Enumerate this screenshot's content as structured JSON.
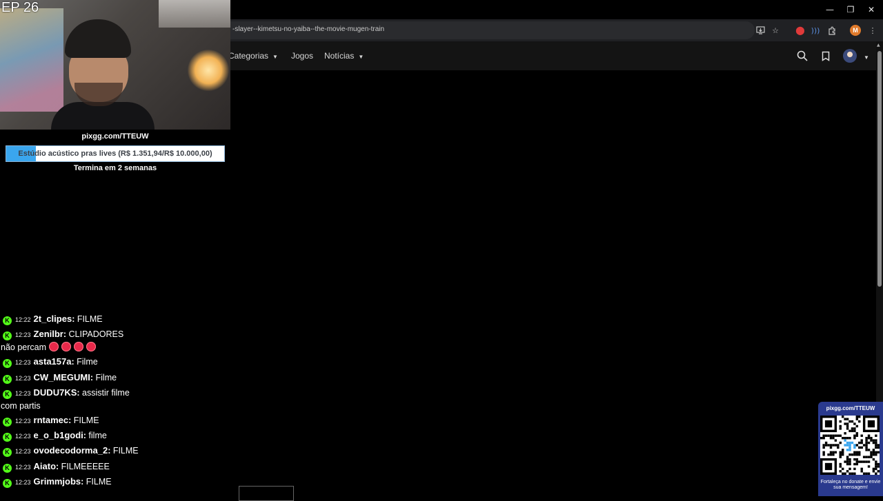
{
  "stream": {
    "episode_label": "EP 26",
    "pix_link": "pixgg.com/TTEUW",
    "goal": {
      "text": "Estúdio acústico pras lives (R$ 1.351,94/R$ 10.000,00)",
      "progress": 0.135,
      "ends": "Termina em 2 semanas"
    },
    "qr": {
      "link": "pixgg.com/TTEUW",
      "caption": "Fortaleça no donate e envie sua mensagem!"
    }
  },
  "chat": {
    "badge_letter": "K",
    "messages": [
      {
        "time": "12:22",
        "user": "2t_clipes",
        "text": "FILME",
        "emotes": 0
      },
      {
        "time": "12:23",
        "user": "Zenilbr",
        "text": "CLIPADORES não percam",
        "emotes": 4
      },
      {
        "time": "12:23",
        "user": "asta157a",
        "text": "Filme",
        "emotes": 0
      },
      {
        "time": "12:23",
        "user": "CW_MEGUMI",
        "text": "Filme",
        "emotes": 0
      },
      {
        "time": "12:23",
        "user": "DUDU7KS",
        "text": "assistir filme com partis",
        "emotes": 0
      },
      {
        "time": "12:23",
        "user": "rntamec",
        "text": "FILME",
        "emotes": 0
      },
      {
        "time": "12:23",
        "user": "e_o_b1godi",
        "text": "filme",
        "emotes": 0
      },
      {
        "time": "12:23",
        "user": "ovodecodorma_2",
        "text": "FILME",
        "emotes": 0
      },
      {
        "time": "12:23",
        "user": "Aiato",
        "text": "FILMEEEEE",
        "emotes": 0
      },
      {
        "time": "12:23",
        "user": "Grimmjobs",
        "text": "FILME",
        "emotes": 0
      }
    ]
  },
  "browser": {
    "url": "-slayer--kimetsu-no-yaiba--the-movie-mugen-train",
    "profile_initial": "M",
    "nav": {
      "categorias": "Categorias",
      "jogos": "Jogos",
      "noticias": "Notícias"
    },
    "icons": {
      "install": "install-icon",
      "bookmark_star": "star-icon",
      "extension_red": "extension-icon",
      "extension_wave": "extension-icon",
      "extensions": "puzzle-icon",
      "menu": "more-vert-icon",
      "search": "search-icon",
      "bookmark": "bookmark-icon"
    },
    "window": {
      "minimize": "—",
      "restore": "❐",
      "close": "✕"
    }
  }
}
